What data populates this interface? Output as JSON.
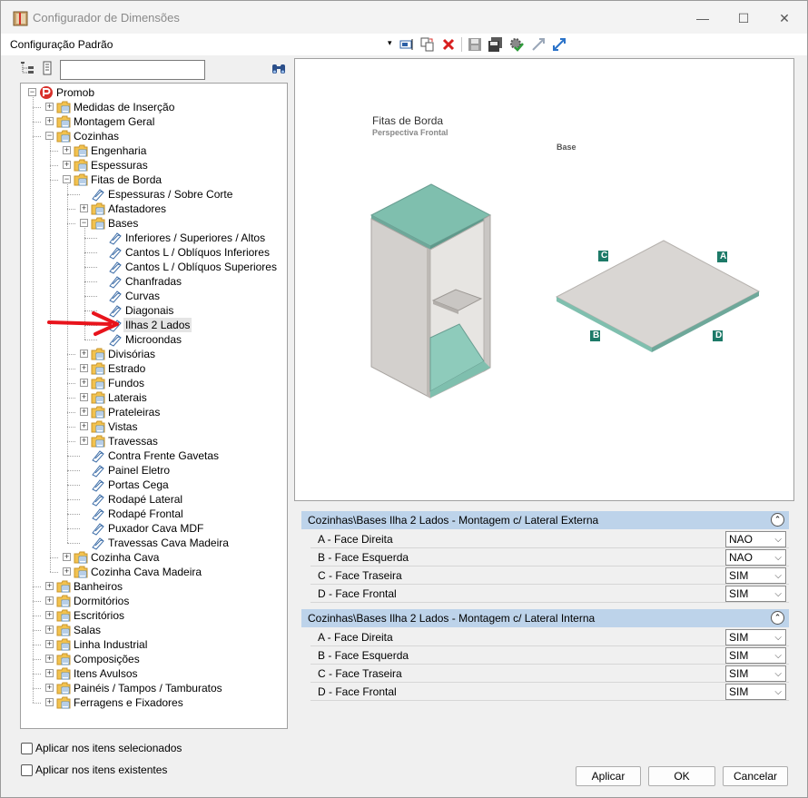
{
  "window": {
    "title": "Configurador de Dimensões",
    "minimize_glyph": "—",
    "maximize_glyph": "☐",
    "close_glyph": "✕"
  },
  "toolbar": {
    "config_label": "Configuração Padrão",
    "dropdown_glyph": "▾",
    "icons": [
      "rename-icon",
      "copy-icon",
      "delete-icon",
      "save-icon",
      "save-all-icon",
      "settings-check-icon",
      "collapse-icon",
      "expand-icon"
    ],
    "delete_color": "#d81e1e"
  },
  "tree": {
    "search_value": "",
    "items": [
      {
        "label": "Promob",
        "level": 0,
        "expander": "−",
        "icon": "promob-logo-icon"
      },
      {
        "label": "Medidas de Inserção",
        "level": 1,
        "expander": "+",
        "icon": "folder-icon"
      },
      {
        "label": "Montagem Geral",
        "level": 1,
        "expander": "+",
        "icon": "folder-icon"
      },
      {
        "label": "Cozinhas",
        "level": 1,
        "expander": "−",
        "icon": "folder-icon"
      },
      {
        "label": "Engenharia",
        "level": 2,
        "expander": "+",
        "icon": "folder-icon"
      },
      {
        "label": "Espessuras",
        "level": 2,
        "expander": "+",
        "icon": "folder-icon"
      },
      {
        "label": "Fitas de Borda",
        "level": 2,
        "expander": "−",
        "icon": "folder-icon"
      },
      {
        "label": "Espessuras / Sobre Corte",
        "level": 3,
        "expander": "",
        "icon": "tag-icon"
      },
      {
        "label": "Afastadores",
        "level": 3,
        "expander": "+",
        "icon": "folder-icon"
      },
      {
        "label": "Bases",
        "level": 3,
        "expander": "−",
        "icon": "folder-icon"
      },
      {
        "label": "Inferiores / Superiores / Altos",
        "level": 4,
        "expander": "",
        "icon": "tag-icon"
      },
      {
        "label": "Cantos L / Oblíquos Inferiores",
        "level": 4,
        "expander": "",
        "icon": "tag-icon"
      },
      {
        "label": "Cantos L / Oblíquos Superiores",
        "level": 4,
        "expander": "",
        "icon": "tag-icon"
      },
      {
        "label": "Chanfradas",
        "level": 4,
        "expander": "",
        "icon": "tag-icon"
      },
      {
        "label": "Curvas",
        "level": 4,
        "expander": "",
        "icon": "tag-icon"
      },
      {
        "label": "Diagonais",
        "level": 4,
        "expander": "",
        "icon": "tag-icon"
      },
      {
        "label": "Ilhas 2 Lados",
        "level": 4,
        "expander": "",
        "icon": "tag-icon",
        "selected": true
      },
      {
        "label": "Microondas",
        "level": 4,
        "expander": "",
        "icon": "tag-icon"
      },
      {
        "label": "Divisórias",
        "level": 3,
        "expander": "+",
        "icon": "folder-icon"
      },
      {
        "label": "Estrado",
        "level": 3,
        "expander": "+",
        "icon": "folder-icon"
      },
      {
        "label": "Fundos",
        "level": 3,
        "expander": "+",
        "icon": "folder-icon"
      },
      {
        "label": "Laterais",
        "level": 3,
        "expander": "+",
        "icon": "folder-icon"
      },
      {
        "label": "Prateleiras",
        "level": 3,
        "expander": "+",
        "icon": "folder-icon"
      },
      {
        "label": "Vistas",
        "level": 3,
        "expander": "+",
        "icon": "folder-icon"
      },
      {
        "label": "Travessas",
        "level": 3,
        "expander": "+",
        "icon": "folder-icon"
      },
      {
        "label": "Contra Frente Gavetas",
        "level": 3,
        "expander": "",
        "icon": "tag-icon"
      },
      {
        "label": "Painel Eletro",
        "level": 3,
        "expander": "",
        "icon": "tag-icon"
      },
      {
        "label": "Portas Cega",
        "level": 3,
        "expander": "",
        "icon": "tag-icon"
      },
      {
        "label": "Rodapé Lateral",
        "level": 3,
        "expander": "",
        "icon": "tag-icon"
      },
      {
        "label": "Rodapé Frontal",
        "level": 3,
        "expander": "",
        "icon": "tag-icon"
      },
      {
        "label": "Puxador Cava MDF",
        "level": 3,
        "expander": "",
        "icon": "tag-icon"
      },
      {
        "label": "Travessas Cava Madeira",
        "level": 3,
        "expander": "",
        "icon": "tag-icon"
      },
      {
        "label": "Cozinha Cava",
        "level": 2,
        "expander": "+",
        "icon": "folder-icon"
      },
      {
        "label": "Cozinha Cava Madeira",
        "level": 2,
        "expander": "+",
        "icon": "folder-icon"
      },
      {
        "label": "Banheiros",
        "level": 1,
        "expander": "+",
        "icon": "folder-icon"
      },
      {
        "label": "Dormitórios",
        "level": 1,
        "expander": "+",
        "icon": "folder-icon"
      },
      {
        "label": "Escritórios",
        "level": 1,
        "expander": "+",
        "icon": "folder-icon"
      },
      {
        "label": "Salas",
        "level": 1,
        "expander": "+",
        "icon": "folder-icon"
      },
      {
        "label": "Linha Industrial",
        "level": 1,
        "expander": "+",
        "icon": "folder-icon"
      },
      {
        "label": "Composições",
        "level": 1,
        "expander": "+",
        "icon": "folder-icon"
      },
      {
        "label": "Itens Avulsos",
        "level": 1,
        "expander": "+",
        "icon": "folder-icon"
      },
      {
        "label": "Painéis / Tampos / Tamburatos",
        "level": 1,
        "expander": "+",
        "icon": "folder-icon"
      },
      {
        "label": "Ferragens e Fixadores",
        "level": 1,
        "expander": "+",
        "icon": "folder-icon"
      }
    ]
  },
  "preview": {
    "title": "Fitas de Borda",
    "subtitle": "Perspectiva Frontal",
    "base_label": "Base",
    "edge_labels": {
      "a": "A",
      "b": "B",
      "c": "C",
      "d": "D"
    },
    "edge_color": "#7fbfae",
    "label_color": "#1d7a68",
    "panel_color": "#d9d6d3"
  },
  "sections": [
    {
      "title": "Cozinhas\\Bases Ilha 2 Lados - Montagem c/ Lateral Externa",
      "collapse_glyph": "⌃",
      "rows": [
        {
          "label": "A - Face Direita",
          "value": "NAO"
        },
        {
          "label": "B - Face Esquerda",
          "value": "NAO"
        },
        {
          "label": "C - Face Traseira",
          "value": "SIM"
        },
        {
          "label": "D - Face Frontal",
          "value": "SIM"
        }
      ]
    },
    {
      "title": "Cozinhas\\Bases Ilha 2 Lados - Montagem c/ Lateral Interna",
      "collapse_glyph": "⌃",
      "rows": [
        {
          "label": "A - Face Direita",
          "value": "SIM"
        },
        {
          "label": "B - Face Esquerda",
          "value": "SIM"
        },
        {
          "label": "C - Face Traseira",
          "value": "SIM"
        },
        {
          "label": "D - Face Frontal",
          "value": "SIM"
        }
      ]
    }
  ],
  "dropdown_glyph": "⌵",
  "options": {
    "apply_selected": "Aplicar nos itens selecionados",
    "apply_existing": "Aplicar nos itens existentes"
  },
  "buttons": {
    "apply": "Aplicar",
    "ok": "OK",
    "cancel": "Cancelar"
  },
  "annotation_arrow_color": "#e8141c"
}
